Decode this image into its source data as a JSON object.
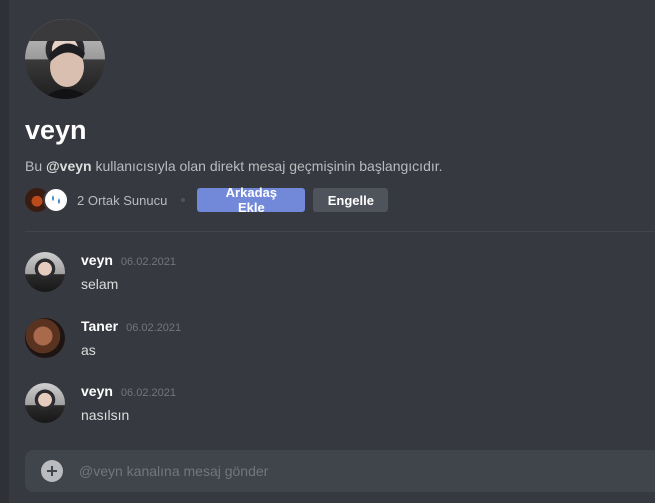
{
  "profile": {
    "username": "veyn",
    "intro_prefix": "Bu ",
    "intro_mention": "@veyn",
    "intro_suffix": " kullanıcısıyla olan direkt mesaj geçmişinin başlangıcıdır.",
    "mutual_servers": "2 Ortak Sunucu",
    "add_friend_label": "Arkadaş Ekle",
    "block_label": "Engelle"
  },
  "messages": [
    {
      "author": "veyn",
      "time": "06.02.2021",
      "text": "selam",
      "avatar": "veyn-avatar"
    },
    {
      "author": "Taner",
      "time": "06.02.2021",
      "text": "as",
      "avatar": "taner-avatar"
    },
    {
      "author": "veyn",
      "time": "06.02.2021",
      "text": "nasılsın",
      "avatar": "veyn-avatar"
    }
  ],
  "composer": {
    "placeholder": "@veyn kanalına mesaj gönder",
    "value": ""
  },
  "colors": {
    "background": "#36393f",
    "primary_button": "#7289da",
    "secondary_button": "#4f545c",
    "composer": "#40444b"
  },
  "icons": [
    "plus-circle-icon",
    "server-icon"
  ]
}
